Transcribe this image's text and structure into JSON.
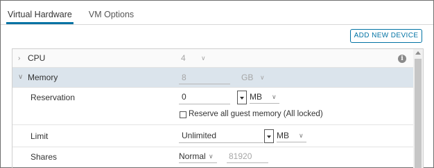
{
  "tabs": [
    {
      "label": "Virtual Hardware",
      "active": true
    },
    {
      "label": "VM Options",
      "active": false
    }
  ],
  "add_device_button": "ADD NEW DEVICE",
  "cpu": {
    "label": "CPU",
    "value": "4"
  },
  "memory": {
    "label": "Memory",
    "value": "8",
    "unit": "GB",
    "reservation": {
      "label": "Reservation",
      "value": "0",
      "unit": "MB"
    },
    "reserve_all": {
      "label": "Reserve all guest memory (All locked)",
      "checked": false
    },
    "limit": {
      "label": "Limit",
      "value": "Unlimited",
      "unit": "MB"
    },
    "shares": {
      "label": "Shares",
      "level": "Normal",
      "value": "81920"
    }
  },
  "colors": {
    "accent": "#0072a3",
    "expanded_row": "#dbe4ec"
  }
}
